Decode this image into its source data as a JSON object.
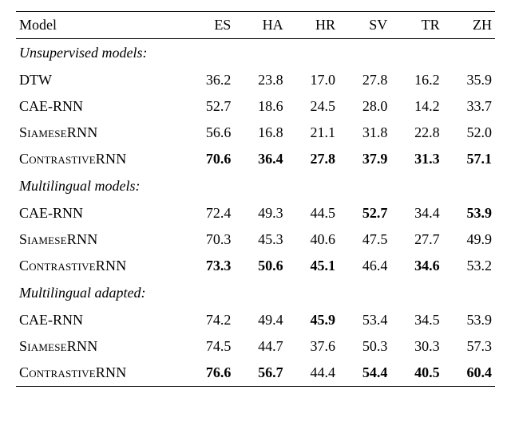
{
  "chart_data": {
    "type": "table",
    "columns": [
      "ES",
      "HA",
      "HR",
      "SV",
      "TR",
      "ZH"
    ],
    "groups": [
      {
        "name": "Unsupervised models:",
        "rows": [
          {
            "name": "DTW",
            "sc": false,
            "values": [
              36.2,
              23.8,
              17.0,
              27.8,
              16.2,
              35.9
            ],
            "bold": [
              false,
              false,
              false,
              false,
              false,
              false
            ]
          },
          {
            "name": "CAE-RNN",
            "sc": false,
            "values": [
              52.7,
              18.6,
              24.5,
              28.0,
              14.2,
              33.7
            ],
            "bold": [
              false,
              false,
              false,
              false,
              false,
              false
            ]
          },
          {
            "name": "SiameseRNN",
            "sc": true,
            "values": [
              56.6,
              16.8,
              21.1,
              31.8,
              22.8,
              52.0
            ],
            "bold": [
              false,
              false,
              false,
              false,
              false,
              false
            ]
          },
          {
            "name": "ContrastiveRNN",
            "sc": true,
            "values": [
              70.6,
              36.4,
              27.8,
              37.9,
              31.3,
              57.1
            ],
            "bold": [
              true,
              true,
              true,
              true,
              true,
              true
            ]
          }
        ]
      },
      {
        "name": "Multilingual models:",
        "rows": [
          {
            "name": "CAE-RNN",
            "sc": false,
            "values": [
              72.4,
              49.3,
              44.5,
              52.7,
              34.4,
              53.9
            ],
            "bold": [
              false,
              false,
              false,
              true,
              false,
              true
            ]
          },
          {
            "name": "SiameseRNN",
            "sc": true,
            "values": [
              70.3,
              45.3,
              40.6,
              47.5,
              27.7,
              49.9
            ],
            "bold": [
              false,
              false,
              false,
              false,
              false,
              false
            ]
          },
          {
            "name": "ContrastiveRNN",
            "sc": true,
            "values": [
              73.3,
              50.6,
              45.1,
              46.4,
              34.6,
              53.2
            ],
            "bold": [
              true,
              true,
              true,
              false,
              true,
              false
            ]
          }
        ]
      },
      {
        "name": "Multilingual adapted:",
        "rows": [
          {
            "name": "CAE-RNN",
            "sc": false,
            "values": [
              74.2,
              49.4,
              45.9,
              53.4,
              34.5,
              53.9
            ],
            "bold": [
              false,
              false,
              true,
              false,
              false,
              false
            ]
          },
          {
            "name": "SiameseRNN",
            "sc": true,
            "values": [
              74.5,
              44.7,
              37.6,
              50.3,
              30.3,
              57.3
            ],
            "bold": [
              false,
              false,
              false,
              false,
              false,
              false
            ]
          },
          {
            "name": "ContrastiveRNN",
            "sc": true,
            "values": [
              76.6,
              56.7,
              44.4,
              54.4,
              40.5,
              60.4
            ],
            "bold": [
              true,
              true,
              false,
              true,
              true,
              true
            ]
          }
        ]
      }
    ]
  },
  "header": {
    "model_label": "Model"
  }
}
